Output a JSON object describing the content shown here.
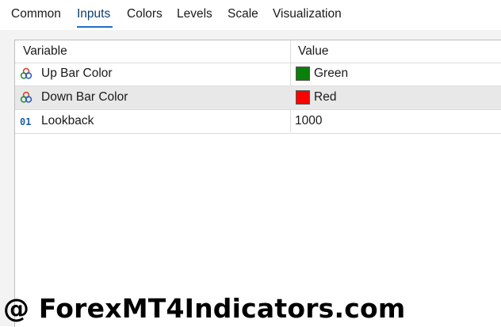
{
  "tabs": [
    {
      "label": "Common"
    },
    {
      "label": "Inputs"
    },
    {
      "label": "Colors"
    },
    {
      "label": "Levels"
    },
    {
      "label": "Scale"
    },
    {
      "label": "Visualization"
    }
  ],
  "active_tab": "Inputs",
  "table": {
    "headers": {
      "variable": "Variable",
      "value": "Value"
    },
    "rows": [
      {
        "name": "Up Bar Color",
        "value": "Green",
        "swatch": "#0a7f0a",
        "icon": "color-palette-icon"
      },
      {
        "name": "Down Bar Color",
        "value": "Red",
        "swatch": "#ff0000",
        "icon": "color-palette-icon",
        "selected": true
      },
      {
        "name": "Lookback",
        "value": "1000",
        "icon": "integer-icon",
        "icon_text": "01"
      }
    ]
  },
  "watermark": "@ ForexMT4Indicators.com",
  "colors": {
    "accent": "#1e6fc8",
    "selected_row": "#e8e8e8"
  }
}
